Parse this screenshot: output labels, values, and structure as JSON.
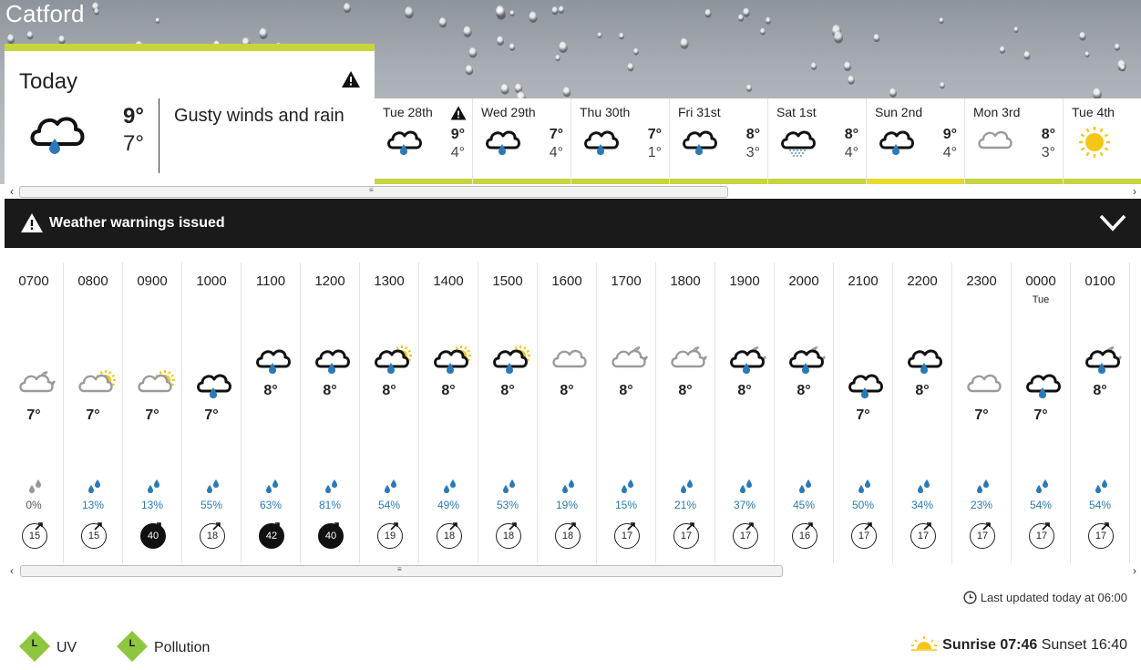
{
  "location": "Catford",
  "today": {
    "title": "Today",
    "high": "9°",
    "low": "7°",
    "description": "Gusty winds and rain",
    "icon": "cloud-rain-icon",
    "warning": true
  },
  "days": [
    {
      "name": "Tue 28th",
      "high": "9°",
      "low": "4°",
      "icon": "cloud-rain-icon",
      "warning": true,
      "bar": "green"
    },
    {
      "name": "Wed 29th",
      "high": "7°",
      "low": "4°",
      "icon": "cloud-rain-icon",
      "warning": false,
      "bar": "green"
    },
    {
      "name": "Thu 30th",
      "high": "7°",
      "low": "1°",
      "icon": "cloud-rain-icon",
      "warning": false,
      "bar": "green"
    },
    {
      "name": "Fri 31st",
      "high": "8°",
      "low": "3°",
      "icon": "cloud-rain-icon",
      "warning": false,
      "bar": "green"
    },
    {
      "name": "Sat 1st",
      "high": "8°",
      "low": "4°",
      "icon": "cloud-drizzle-icon",
      "warning": false,
      "bar": "green"
    },
    {
      "name": "Sun 2nd",
      "high": "9°",
      "low": "4°",
      "icon": "cloud-rain-icon",
      "warning": false,
      "bar": "yellow"
    },
    {
      "name": "Mon 3rd",
      "high": "8°",
      "low": "3°",
      "icon": "grey-cloud-icon",
      "warning": false,
      "bar": "green"
    },
    {
      "name": "Tue 4th",
      "high": "",
      "low": "",
      "icon": "sun-icon",
      "warning": false,
      "bar": "green"
    }
  ],
  "warnings": {
    "label": "Weather warnings issued"
  },
  "hours": [
    {
      "time": "0700",
      "day": "",
      "icon": "grey-cloud-moon-icon",
      "temp": "7°",
      "level": "low",
      "rain": "0%",
      "wind": "15",
      "wind_dark": false
    },
    {
      "time": "0800",
      "day": "",
      "icon": "grey-cloud-sun-icon",
      "temp": "7°",
      "level": "low",
      "rain": "13%",
      "wind": "15",
      "wind_dark": false
    },
    {
      "time": "0900",
      "day": "",
      "icon": "grey-cloud-sun-icon",
      "temp": "7°",
      "level": "low",
      "rain": "13%",
      "wind": "40",
      "wind_dark": true
    },
    {
      "time": "1000",
      "day": "",
      "icon": "cloud-rain-icon",
      "temp": "7°",
      "level": "low",
      "rain": "55%",
      "wind": "18",
      "wind_dark": false
    },
    {
      "time": "1100",
      "day": "",
      "icon": "cloud-rain-icon",
      "temp": "8°",
      "level": "high",
      "rain": "63%",
      "wind": "42",
      "wind_dark": true
    },
    {
      "time": "1200",
      "day": "",
      "icon": "cloud-rain-icon",
      "temp": "8°",
      "level": "high",
      "rain": "81%",
      "wind": "40",
      "wind_dark": true
    },
    {
      "time": "1300",
      "day": "",
      "icon": "cloud-rain-sun-icon",
      "temp": "8°",
      "level": "high",
      "rain": "54%",
      "wind": "19",
      "wind_dark": false
    },
    {
      "time": "1400",
      "day": "",
      "icon": "cloud-rain-sun-icon",
      "temp": "8°",
      "level": "high",
      "rain": "49%",
      "wind": "18",
      "wind_dark": false
    },
    {
      "time": "1500",
      "day": "",
      "icon": "cloud-rain-sun-icon",
      "temp": "8°",
      "level": "high",
      "rain": "53%",
      "wind": "18",
      "wind_dark": false
    },
    {
      "time": "1600",
      "day": "",
      "icon": "grey-cloud-icon",
      "temp": "8°",
      "level": "high",
      "rain": "19%",
      "wind": "18",
      "wind_dark": false
    },
    {
      "time": "1700",
      "day": "",
      "icon": "grey-cloud-moon-icon",
      "temp": "8°",
      "level": "high",
      "rain": "15%",
      "wind": "17",
      "wind_dark": false
    },
    {
      "time": "1800",
      "day": "",
      "icon": "grey-cloud-moon-icon",
      "temp": "8°",
      "level": "high",
      "rain": "21%",
      "wind": "17",
      "wind_dark": false
    },
    {
      "time": "1900",
      "day": "",
      "icon": "cloud-rain-moon-icon",
      "temp": "8°",
      "level": "high",
      "rain": "37%",
      "wind": "17",
      "wind_dark": false
    },
    {
      "time": "2000",
      "day": "",
      "icon": "cloud-rain-moon-icon",
      "temp": "8°",
      "level": "high",
      "rain": "45%",
      "wind": "16",
      "wind_dark": false
    },
    {
      "time": "2100",
      "day": "",
      "icon": "cloud-rain-icon",
      "temp": "7°",
      "level": "low",
      "rain": "50%",
      "wind": "17",
      "wind_dark": false
    },
    {
      "time": "2200",
      "day": "",
      "icon": "cloud-rain-icon",
      "temp": "8°",
      "level": "high",
      "rain": "34%",
      "wind": "17",
      "wind_dark": false
    },
    {
      "time": "2300",
      "day": "",
      "icon": "grey-cloud-icon",
      "temp": "7°",
      "level": "low",
      "rain": "23%",
      "wind": "17",
      "wind_dark": false
    },
    {
      "time": "0000",
      "day": "Tue",
      "icon": "cloud-rain-icon",
      "temp": "7°",
      "level": "low",
      "rain": "54%",
      "wind": "17",
      "wind_dark": false
    },
    {
      "time": "0100",
      "day": "",
      "icon": "cloud-rain-moon-icon",
      "temp": "8°",
      "level": "high",
      "rain": "54%",
      "wind": "17",
      "wind_dark": false
    }
  ],
  "footer": {
    "last_updated": "Last updated today at 06:00",
    "uv_level": "L",
    "uv_label": "UV",
    "pollution_level": "L",
    "pollution_label": "Pollution",
    "sunrise_label": "Sunrise",
    "sunrise_time": "07:46",
    "sunset_label": "Sunset",
    "sunset_time": "16:40"
  },
  "colors": {
    "accent_green": "#c6d43e",
    "accent_yellow": "#e6db2c",
    "rain_blue": "#2a7ab8",
    "badge_green": "#8dc63f"
  }
}
